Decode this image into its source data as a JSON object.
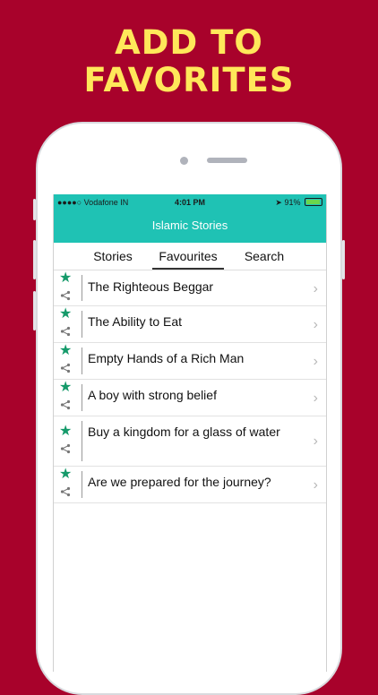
{
  "promo": {
    "line1": "ADD TO",
    "line2": "FAVORITES"
  },
  "status": {
    "carrier": "●●●●○ Vodafone IN",
    "time": "4:01 PM",
    "battery": "91%"
  },
  "header": {
    "title": "Islamic Stories"
  },
  "tabs": [
    {
      "label": "Stories"
    },
    {
      "label": "Favourites"
    },
    {
      "label": "Search"
    }
  ],
  "stories": [
    {
      "title": "The Righteous Beggar"
    },
    {
      "title": "The Ability to Eat"
    },
    {
      "title": "Empty Hands of a Rich Man"
    },
    {
      "title": "A boy with strong belief"
    },
    {
      "title": "Buy a kingdom for a glass of water"
    },
    {
      "title": "Are we prepared for the journey?"
    }
  ],
  "icons": {
    "favorite": "star-icon",
    "share": "share-icon",
    "disclosure": "chevron-right-icon"
  },
  "colors": {
    "background": "#A8022B",
    "headline": "#FFE75A",
    "accent": "#1FC2B4",
    "star": "#159A6A"
  }
}
